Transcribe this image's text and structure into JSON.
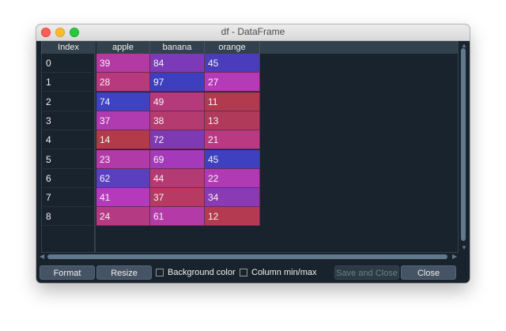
{
  "window": {
    "title": "df - DataFrame"
  },
  "index_header": "Index",
  "columns": [
    "apple",
    "banana",
    "orange"
  ],
  "rows": [
    {
      "index": "0",
      "values": [
        "39",
        "84",
        "45"
      ]
    },
    {
      "index": "1",
      "values": [
        "28",
        "97",
        "27"
      ]
    },
    {
      "index": "2",
      "values": [
        "74",
        "49",
        "11"
      ]
    },
    {
      "index": "3",
      "values": [
        "37",
        "38",
        "13"
      ]
    },
    {
      "index": "4",
      "values": [
        "14",
        "72",
        "21"
      ]
    },
    {
      "index": "5",
      "values": [
        "23",
        "69",
        "45"
      ]
    },
    {
      "index": "6",
      "values": [
        "62",
        "44",
        "22"
      ]
    },
    {
      "index": "7",
      "values": [
        "41",
        "37",
        "34"
      ]
    },
    {
      "index": "8",
      "values": [
        "24",
        "61",
        "12"
      ]
    }
  ],
  "cell_colors": [
    [
      "#b33aa3",
      "#7c3ab8",
      "#4a3cba"
    ],
    [
      "#b83a7e",
      "#3e3fc0",
      "#b53ab8"
    ],
    [
      "#3e43c2",
      "#b53a7c",
      "#b23a4f"
    ],
    [
      "#b03ab0",
      "#b43a6f",
      "#b03a59"
    ],
    [
      "#b33a48",
      "#7e3ab3",
      "#b93a82"
    ],
    [
      "#b23aa8",
      "#a43ab9",
      "#3e40bf"
    ],
    [
      "#5a40bf",
      "#b43a74",
      "#b03ab4"
    ],
    [
      "#b43abb",
      "#b63a62",
      "#8a3ab3"
    ],
    [
      "#b43a84",
      "#b43aa8",
      "#b33a50"
    ]
  ],
  "buttons": {
    "format": "Format",
    "resize": "Resize",
    "save_and_close": "Save and Close",
    "close": "Close"
  },
  "checkboxes": {
    "background_color": "Background color",
    "column_minmax": "Column min/max"
  }
}
